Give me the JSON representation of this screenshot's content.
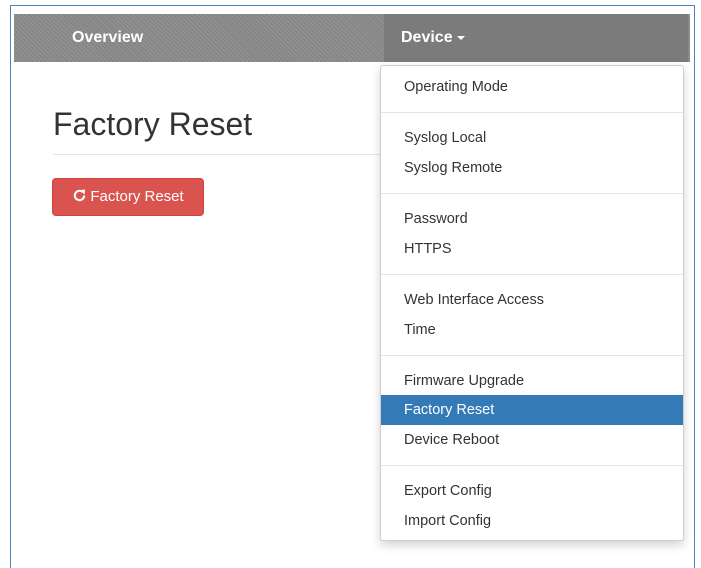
{
  "navbar": {
    "overview_label": "Overview",
    "device_label": "Device",
    "background_color": "#8d8d8d",
    "active_color": "#7b7b7b"
  },
  "page": {
    "title": "Factory Reset",
    "button_label": "Factory Reset",
    "button_icon": "refresh-icon",
    "button_color": "#d9534f"
  },
  "dropdown": {
    "active_color": "#337ab7",
    "items": [
      {
        "label": "Operating Mode"
      },
      {
        "label": "Syslog Local"
      },
      {
        "label": "Syslog Remote"
      },
      {
        "label": "Password"
      },
      {
        "label": "HTTPS"
      },
      {
        "label": "Web Interface Access"
      },
      {
        "label": "Time"
      },
      {
        "label": "Firmware Upgrade"
      },
      {
        "label": "Factory Reset",
        "active": true
      },
      {
        "label": "Device Reboot"
      },
      {
        "label": "Export Config"
      },
      {
        "label": "Import Config"
      }
    ]
  }
}
